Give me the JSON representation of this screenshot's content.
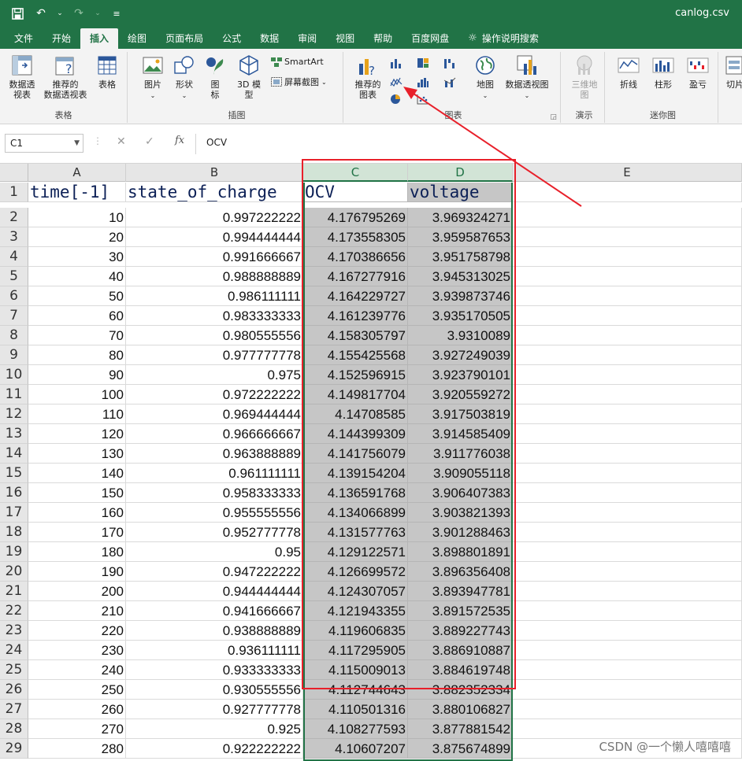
{
  "window": {
    "filename": "canlog.csv"
  },
  "tabs": [
    {
      "label": "文件",
      "name": "file"
    },
    {
      "label": "开始",
      "name": "home"
    },
    {
      "label": "插入",
      "name": "insert",
      "active": true
    },
    {
      "label": "绘图",
      "name": "draw"
    },
    {
      "label": "页面布局",
      "name": "page-layout"
    },
    {
      "label": "公式",
      "name": "formulas"
    },
    {
      "label": "数据",
      "name": "data"
    },
    {
      "label": "审阅",
      "name": "review"
    },
    {
      "label": "视图",
      "name": "view"
    },
    {
      "label": "帮助",
      "name": "help"
    },
    {
      "label": "百度网盘",
      "name": "baidu-netdisk"
    }
  ],
  "tell_me": "操作说明搜索",
  "ribbon": {
    "tables": {
      "group": "表格",
      "pivot": "数据透\n视表",
      "rec_pivot": "推荐的\n数据透视表",
      "table": "表格"
    },
    "illustrations": {
      "group": "插图",
      "pictures": "图片",
      "shapes": "形状",
      "icons": "图\n标",
      "model3d": "3D 模\n型",
      "smartart": "SmartArt",
      "screenshot": "屏幕截图"
    },
    "charts": {
      "group": "图表",
      "recommended": "推荐的\n图表",
      "maps": "地图",
      "pivot_chart": "数据透视图"
    },
    "tours": {
      "group": "演示",
      "map3d": "三维地\n图"
    },
    "sparklines": {
      "group": "迷你图",
      "line": "折线",
      "column": "柱形",
      "winloss": "盈亏"
    },
    "slicer": "切片"
  },
  "formula_bar": {
    "name_box": "C1",
    "value": "OCV"
  },
  "columns": [
    "A",
    "B",
    "C",
    "D",
    "E"
  ],
  "sheet": {
    "headers": [
      "time[-1]",
      "state_of_charge",
      "OCV",
      "voltage"
    ],
    "rows": [
      [
        "10",
        "0.997222222",
        "4.176795269",
        "3.969324271"
      ],
      [
        "20",
        "0.994444444",
        "4.173558305",
        "3.959587653"
      ],
      [
        "30",
        "0.991666667",
        "4.170386656",
        "3.951758798"
      ],
      [
        "40",
        "0.988888889",
        "4.167277916",
        "3.945313025"
      ],
      [
        "50",
        "0.986111111",
        "4.164229727",
        "3.939873746"
      ],
      [
        "60",
        "0.983333333",
        "4.161239776",
        "3.935170505"
      ],
      [
        "70",
        "0.980555556",
        "4.158305797",
        "3.9310089"
      ],
      [
        "80",
        "0.977777778",
        "4.155425568",
        "3.927249039"
      ],
      [
        "90",
        "0.975",
        "4.152596915",
        "3.923790101"
      ],
      [
        "100",
        "0.972222222",
        "4.149817704",
        "3.920559272"
      ],
      [
        "110",
        "0.969444444",
        "4.14708585",
        "3.917503819"
      ],
      [
        "120",
        "0.966666667",
        "4.144399309",
        "3.914585409"
      ],
      [
        "130",
        "0.963888889",
        "4.141756079",
        "3.911776038"
      ],
      [
        "140",
        "0.961111111",
        "4.139154204",
        "3.909055118"
      ],
      [
        "150",
        "0.958333333",
        "4.136591768",
        "3.906407383"
      ],
      [
        "160",
        "0.955555556",
        "4.134066899",
        "3.903821393"
      ],
      [
        "170",
        "0.952777778",
        "4.131577763",
        "3.901288463"
      ],
      [
        "180",
        "0.95",
        "4.129122571",
        "3.898801891"
      ],
      [
        "190",
        "0.947222222",
        "4.126699572",
        "3.896356408"
      ],
      [
        "200",
        "0.944444444",
        "4.124307057",
        "3.893947781"
      ],
      [
        "210",
        "0.941666667",
        "4.121943355",
        "3.891572535"
      ],
      [
        "220",
        "0.938888889",
        "4.119606835",
        "3.889227743"
      ],
      [
        "230",
        "0.936111111",
        "4.117295905",
        "3.886910887"
      ],
      [
        "240",
        "0.933333333",
        "4.115009013",
        "3.884619748"
      ],
      [
        "250",
        "0.930555556",
        "4.112744643",
        "3.882352334"
      ],
      [
        "260",
        "0.927777778",
        "4.110501316",
        "3.880106827"
      ],
      [
        "270",
        "0.925",
        "4.108277593",
        "3.877881542"
      ],
      [
        "280",
        "0.922222222",
        "4.10607207",
        "3.875674899"
      ]
    ]
  },
  "watermark": "CSDN @一个懒人嘻嘻嘻",
  "colors": {
    "excel_green": "#217346",
    "annotation_red": "#e8202a",
    "selection_gray": "#c6c6c6"
  }
}
